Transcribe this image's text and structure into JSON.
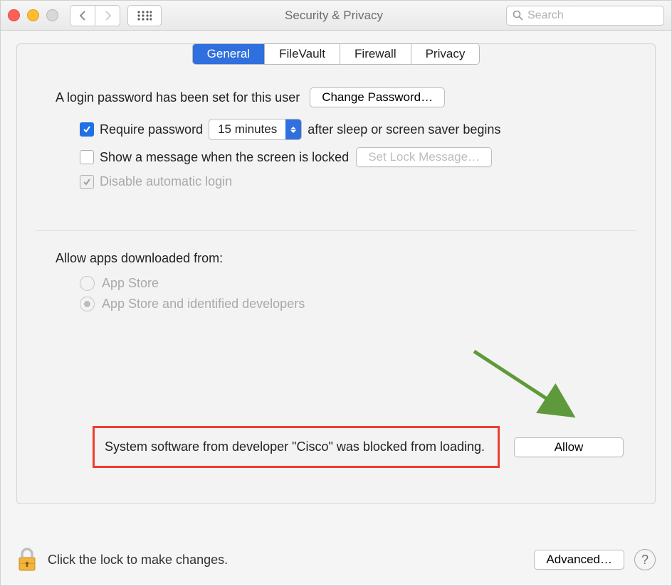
{
  "titlebar": {
    "title": "Security & Privacy",
    "search_placeholder": "Search"
  },
  "tabs": {
    "general": "General",
    "filevault": "FileVault",
    "firewall": "Firewall",
    "privacy": "Privacy"
  },
  "login": {
    "set_text": "A login password has been set for this user",
    "change_btn": "Change Password…",
    "require_label": "Require password",
    "require_delay": "15 minutes",
    "require_suffix": "after sleep or screen saver begins",
    "show_msg_label": "Show a message when the screen is locked",
    "set_lock_btn": "Set Lock Message…",
    "disable_auto": "Disable automatic login"
  },
  "allow_apps": {
    "heading": "Allow apps downloaded from:",
    "opt1": "App Store",
    "opt2": "App Store and identified developers"
  },
  "blocked": {
    "message": "System software from developer \"Cisco\" was blocked from loading.",
    "allow_btn": "Allow"
  },
  "footer": {
    "lock_text": "Click the lock to make changes.",
    "advanced_btn": "Advanced…",
    "help": "?"
  }
}
